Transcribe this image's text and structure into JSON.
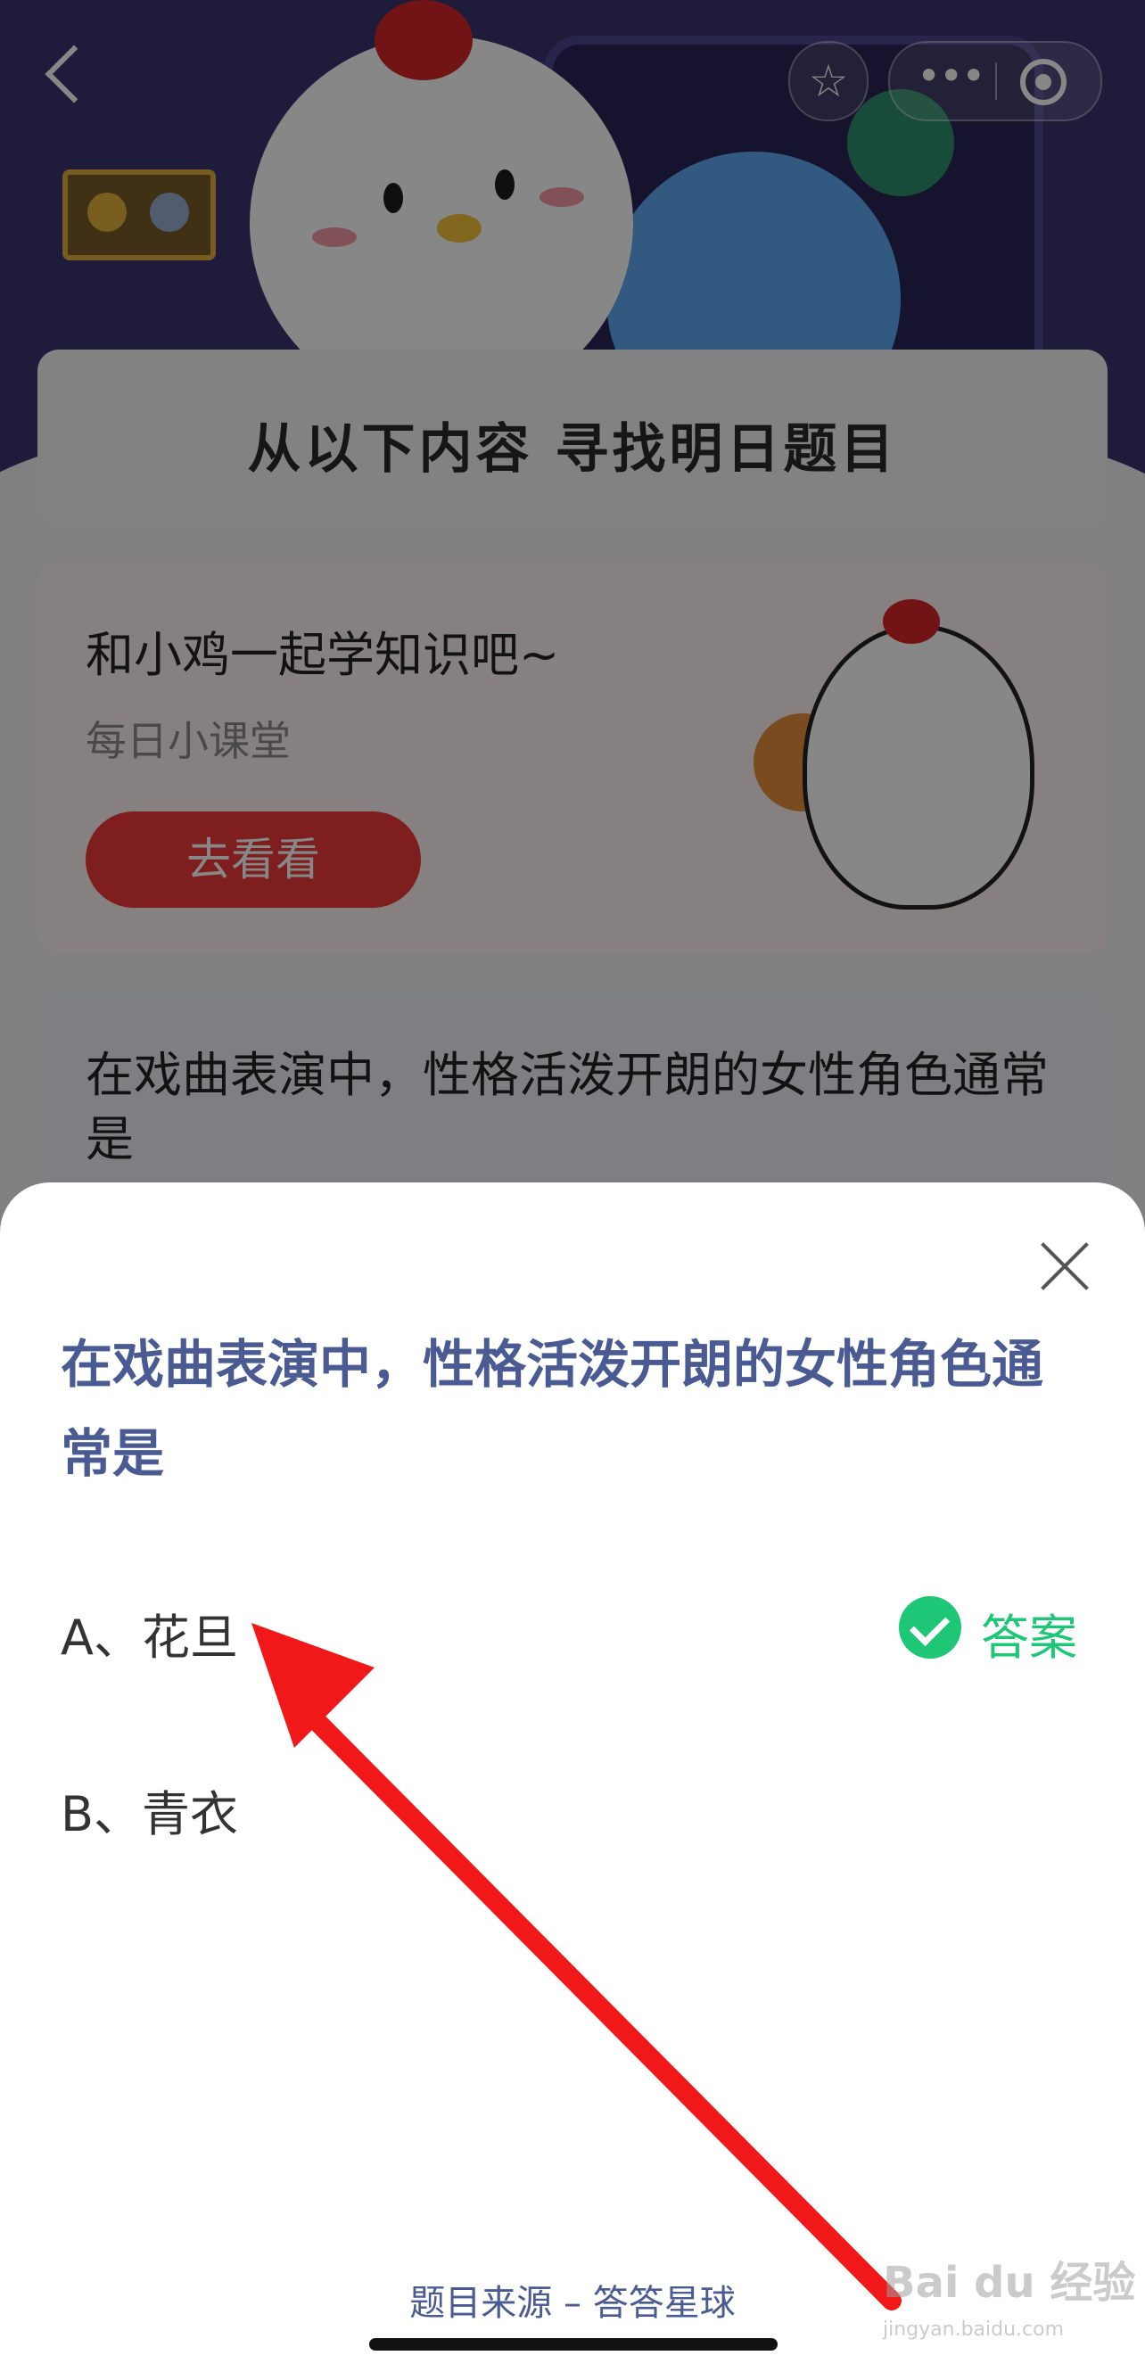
{
  "background": {
    "banner_title": "从以下内容  寻找明日题目",
    "course_card": {
      "title": "和小鸡一起学知识吧~",
      "subtitle": "每日小课堂",
      "button": "去看看"
    },
    "question_preview": "在戏曲表演中，性格活泼开朗的女性角色通常是"
  },
  "nav": {
    "star_icon_glyph": "☆",
    "more_glyph": "•••"
  },
  "sheet": {
    "question": "在戏曲表演中，性格活泼开朗的女性角色通常是",
    "options": [
      {
        "label": "A、花旦",
        "is_answer": true
      },
      {
        "label": "B、青衣",
        "is_answer": false
      }
    ],
    "answer_label": "答案",
    "source": "题目来源 – 答答星球"
  },
  "watermark": {
    "brand": "Bai du 经验",
    "url": "jingyan.baidu.com"
  },
  "colors": {
    "accent_blue": "#4a5a93",
    "answer_green": "#1dc776",
    "button_red": "#ef3a3a",
    "annotation_red": "#f01818"
  }
}
